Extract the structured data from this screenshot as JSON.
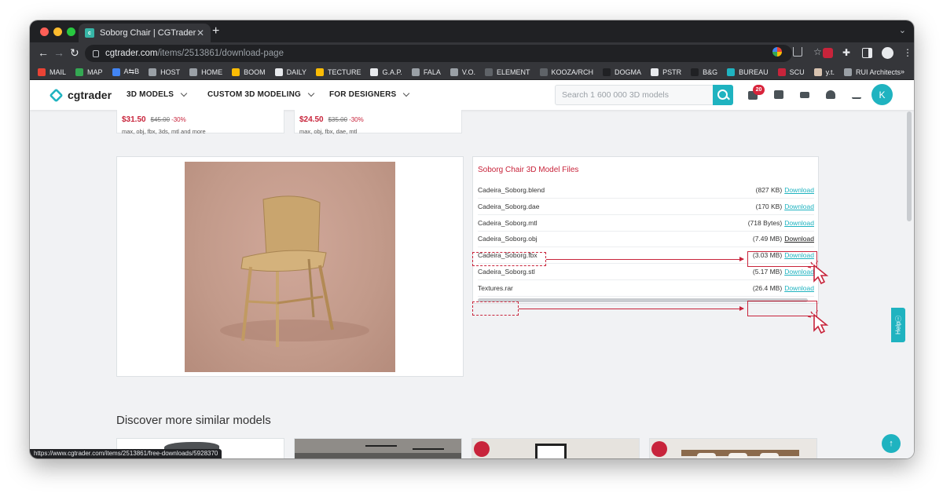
{
  "browser": {
    "tab_title": "Soborg Chair | CGTrader",
    "url_host": "cgtrader.com",
    "url_path": "/items/2513861/download-page",
    "status_url": "https://www.cgtrader.com/items/2513861/free-downloads/5928370",
    "bookmarks": [
      {
        "label": "MAIL",
        "color": "#ea4335"
      },
      {
        "label": "MAP",
        "color": "#34a853"
      },
      {
        "label": "A⇆B",
        "color": "#4285f4"
      },
      {
        "label": "HOST",
        "color": "#9aa0a6"
      },
      {
        "label": "HOME",
        "color": "#9aa0a6"
      },
      {
        "label": "BOOM",
        "color": "#fbbc05"
      },
      {
        "label": "DAILY",
        "color": "#e8eaed"
      },
      {
        "label": "TECTURE",
        "color": "#fbbc05"
      },
      {
        "label": "G.A.P.",
        "color": "#e8eaed"
      },
      {
        "label": "FALA",
        "color": "#9aa0a6"
      },
      {
        "label": "V.O.",
        "color": "#9aa0a6"
      },
      {
        "label": "ELEMENT",
        "color": "#5f6368"
      },
      {
        "label": "KOOZA/RCH",
        "color": "#5f6368"
      },
      {
        "label": "DOGMA",
        "color": "#202124"
      },
      {
        "label": "PSTR",
        "color": "#e8eaed"
      },
      {
        "label": "B&G",
        "color": "#202124"
      },
      {
        "label": "BUREAU",
        "color": "#1fb3c0"
      },
      {
        "label": "SCU",
        "color": "#c8243b"
      },
      {
        "label": "y.t.",
        "color": "#d8c3b0"
      },
      {
        "label": "RUI Architects",
        "color": "#9aa0a6"
      }
    ],
    "bookmarks_more": "»"
  },
  "header": {
    "logo": "cgtrader",
    "menu": [
      "3D MODELS",
      "CUSTOM 3D MODELING",
      "FOR DESIGNERS"
    ],
    "search_placeholder": "Search 1 600 000 3D models",
    "cart_badge": "20",
    "avatar_initial": "K"
  },
  "top_cards": [
    {
      "price": "$31.50",
      "old_price": "$45.00",
      "discount": "-30%",
      "formats": "max, obj, fbx, 3ds, mtl and more"
    },
    {
      "price": "$24.50",
      "old_price": "$35.00",
      "discount": "-30%",
      "formats": "max, obj, fbx, dae, mtl"
    }
  ],
  "files": {
    "title": "Soborg Chair 3D Model Files",
    "rows": [
      {
        "name": "Cadeira_Soborg.blend",
        "size": "(827 KB)",
        "action": "Download"
      },
      {
        "name": "Cadeira_Soborg.dae",
        "size": "(170 KB)",
        "action": "Download"
      },
      {
        "name": "Cadeira_Soborg.mtl",
        "size": "(718 Bytes)",
        "action": "Download"
      },
      {
        "name": "Cadeira_Soborg.obj",
        "size": "(7.49 MB)",
        "action": "Download"
      },
      {
        "name": "Cadeira_Soborg.fbx",
        "size": "(3.03 MB)",
        "action": "Download"
      },
      {
        "name": "Cadeira_Soborg.stl",
        "size": "(5.17 MB)",
        "action": "Download"
      },
      {
        "name": "Textures.rar",
        "size": "(26.4 MB)",
        "action": "Download"
      }
    ]
  },
  "help_label": "Help",
  "discover_title": "Discover more similar models",
  "colors": {
    "accent": "#1fb3c0",
    "price": "#c8243b",
    "annotation": "#c8243b"
  }
}
